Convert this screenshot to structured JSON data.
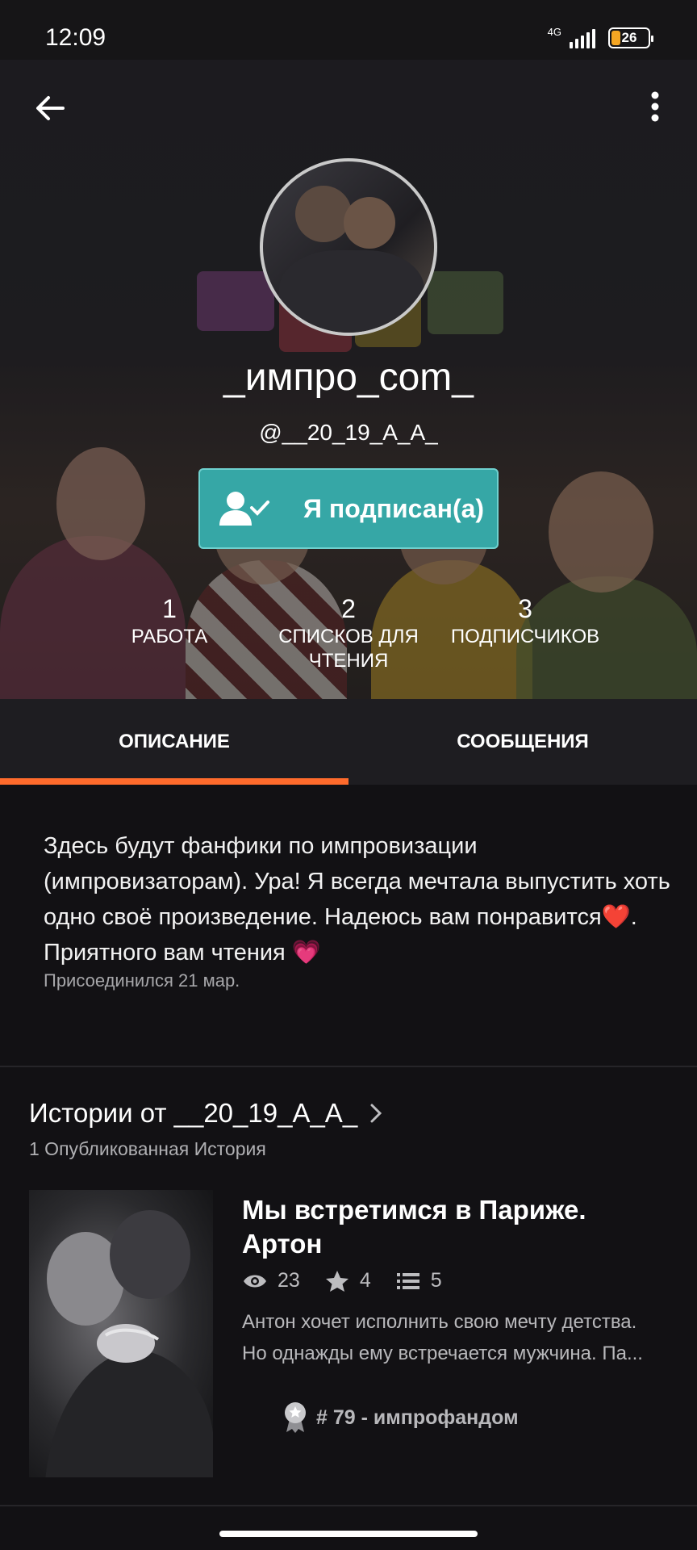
{
  "status_bar": {
    "time": "12:09",
    "network": "4G",
    "battery_level": "26",
    "battery_fraction": 0.26
  },
  "header": {
    "back_icon": "arrow-left-icon",
    "more_icon": "more-vertical-icon"
  },
  "profile": {
    "display_name": "_импро_com_",
    "handle": "@__20_19_A_A_",
    "follow_button_label": "Я подписан(а)",
    "follow_icon": "user-check-icon",
    "stats": [
      {
        "value": "1",
        "label": "РАБОТА"
      },
      {
        "value": "2",
        "label": "СПИСКОВ ДЛЯ ЧТЕНИЯ"
      },
      {
        "value": "3",
        "label": "ПОДПИСЧИКОВ"
      }
    ]
  },
  "tabs": [
    {
      "label": "ОПИСАНИЕ",
      "active": true
    },
    {
      "label": "СООБЩЕНИЯ",
      "active": false
    }
  ],
  "about": {
    "description": "Здесь будут фанфики по импровизации (импровизаторам). Ура! Я всегда мечтала выпустить хоть одно своё произведение. Надеюсь вам понравится❤️. Приятного вам чтения 💗",
    "joined": "Присоединился 21 мар."
  },
  "stories": {
    "title": "Истории от __20_19_A_A_",
    "count_label": "1 Опубликованная История",
    "items": [
      {
        "title": "Мы встретимся в Париже. Артон",
        "reads": "23",
        "votes": "4",
        "parts": "5",
        "description": "Антон хочет исполнить свою мечту детства. Но однажды ему встречается мужчина. Па...",
        "rank": "# 79 - импрофандом"
      }
    ]
  },
  "colors": {
    "accent": "#ff6b2c",
    "follow_button": "#36a7a6",
    "background": "#121114"
  }
}
